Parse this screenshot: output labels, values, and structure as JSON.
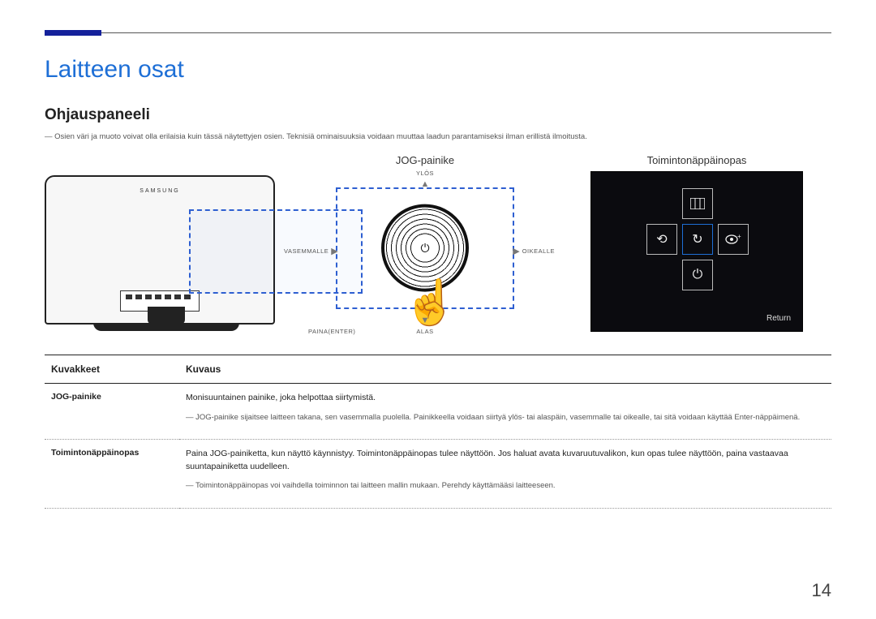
{
  "page_number": "14",
  "chapter_title": "Laitteen osat",
  "section_title": "Ohjauspaneeli",
  "disclaimer": "Osien väri ja muoto voivat olla erilaisia kuin tässä näytettyjen osien. Teknisiä ominaisuuksia voidaan muuttaa laadun parantamiseksi ilman erillistä ilmoitusta.",
  "monitor_brand": "SAMSUNG",
  "jog": {
    "title": "JOG-painike",
    "up": "YLÖS",
    "down": "ALAS",
    "left": "VASEMMALLE",
    "right": "OIKEALLE",
    "press": "PAINA(ENTER)"
  },
  "guide": {
    "title": "Toimintonäppäinopas",
    "return_label": "Return"
  },
  "table": {
    "col_icons": "Kuvakkeet",
    "col_desc": "Kuvaus",
    "rows": [
      {
        "name": "JOG-painike",
        "line1": "Monisuuntainen painike, joka helpottaa siirtymistä.",
        "note": "JOG-painike sijaitsee laitteen takana, sen vasemmalla puolella. Painikkeella voidaan siirtyä ylös- tai alaspäin, vasemmalle tai oikealle, tai sitä voidaan käyttää Enter-näppäimenä."
      },
      {
        "name": "Toimintonäppäinopas",
        "line1": "Paina JOG-painiketta, kun näyttö käynnistyy. Toimintonäppäinopas tulee näyttöön. Jos haluat avata kuvaruutuvalikon, kun opas tulee näyttöön, paina vastaavaa suuntapainiketta uudelleen.",
        "note": "Toimintonäppäinopas voi vaihdella toiminnon tai laitteen mallin mukaan. Perehdy käyttämääsi laitteeseen."
      }
    ]
  }
}
